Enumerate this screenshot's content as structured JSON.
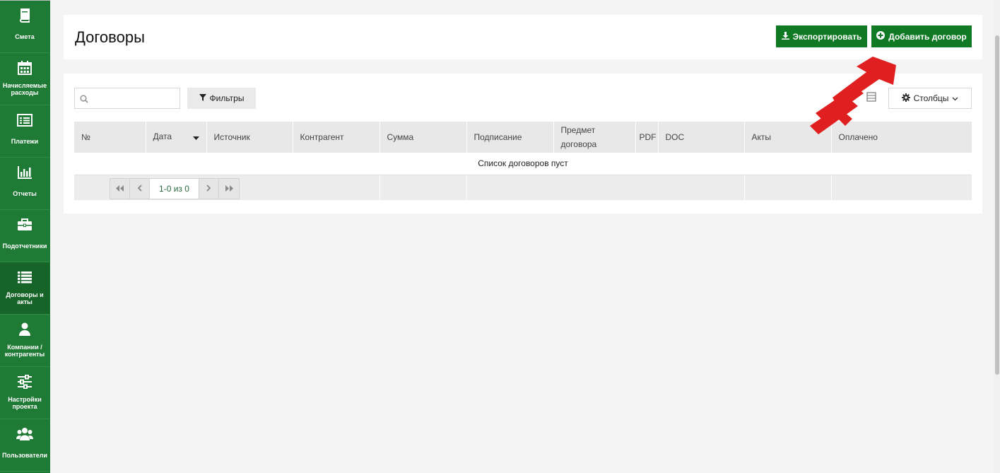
{
  "sidebar": {
    "items": [
      {
        "label": "Смета",
        "icon": "book-icon"
      },
      {
        "label": "Начисляемые расходы",
        "icon": "calendar-icon"
      },
      {
        "label": "Платежи",
        "icon": "card-icon"
      },
      {
        "label": "Отчеты",
        "icon": "bar-chart-icon"
      },
      {
        "label": "Подотчетники",
        "icon": "briefcase-icon"
      },
      {
        "label": "Договоры и акты",
        "icon": "list-icon"
      },
      {
        "label": "Компании / контрагенты",
        "icon": "user-icon"
      },
      {
        "label": "Настройки проекта",
        "icon": "sliders-icon"
      },
      {
        "label": "Пользователи",
        "icon": "users-icon"
      }
    ],
    "active_index": 5
  },
  "header": {
    "title": "Договоры",
    "export_label": "Экспортировать",
    "add_label": "Добавить договор"
  },
  "toolbar": {
    "search_placeholder": "",
    "filters_label": "Фильтры",
    "columns_label": "Столбцы"
  },
  "table": {
    "columns": [
      "№",
      "Дата",
      "Источник",
      "Контрагент",
      "Сумма",
      "Подписание",
      "Предмет договора",
      "PDF",
      "DOC",
      "Акты",
      "Оплачено"
    ],
    "empty_message": "Список договоров пуст"
  },
  "pager": {
    "info": "1-0 из 0"
  },
  "colors": {
    "sidebar": "#1f7a35",
    "primary_button": "#0f7a23",
    "annotation_arrow": "#e02020"
  }
}
